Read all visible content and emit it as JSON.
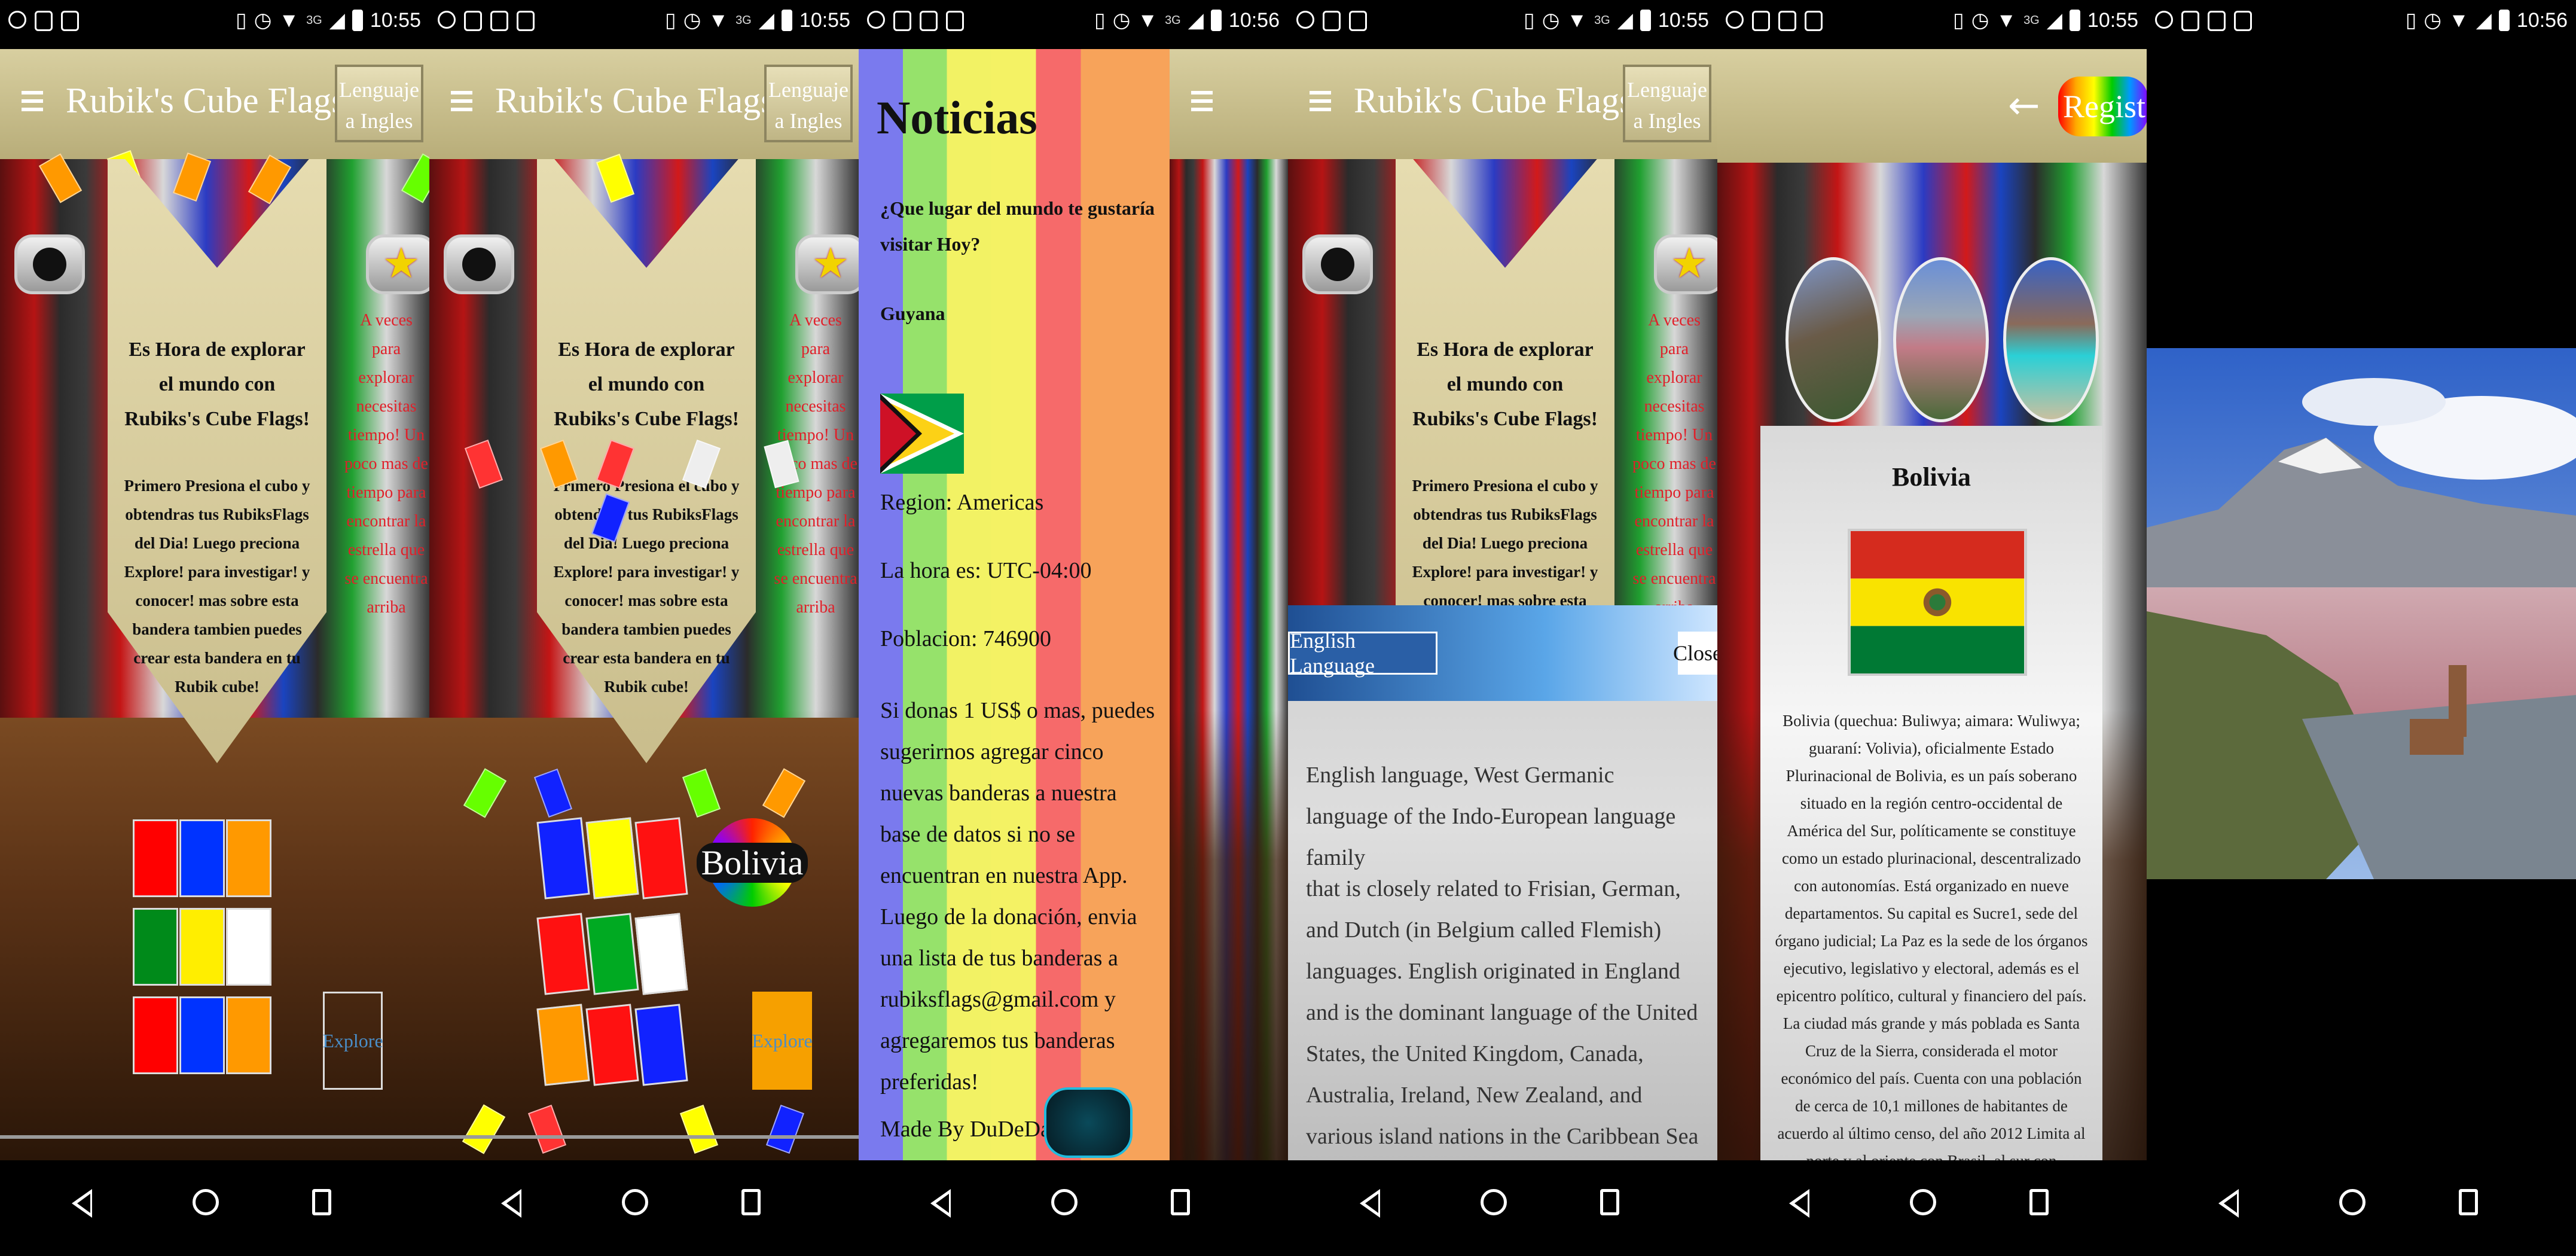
{
  "status": {
    "time_1": "10:55",
    "time_2": "10:55",
    "time_3": "10:56",
    "time_4": "10:55",
    "time_5": "10:55",
    "time_6": "10:55",
    "time_7": "10:56",
    "network": "3G"
  },
  "appbar": {
    "title": "Rubik's Cube Flags",
    "lang_button": "Lenguaje a Ingles"
  },
  "home": {
    "intro": "Es Hora de explorar el mundo con Rubiks's Cube Flags!",
    "instructions": "Primero Presiona el cubo y obtendras tus RubiksFlags del Dia! Luego preciona Explore! para investigar! y conocer! mas sobre esta bandera tambien puedes crear esta bandera en tu Rubik cube!",
    "side_note": "A veces para explorar necesitas tiempo! Un poco mas de tiempo para encontrar la estrella que se encuentra arriba",
    "explore_label": "Explore",
    "country_pill": "Bolivia",
    "cube_colors": [
      "#ff0000",
      "#0033ff",
      "#ff9900",
      "#008a1a",
      "#ffee00",
      "#ffffff",
      "#ff0000",
      "#0033ff",
      "#ff9900"
    ],
    "accent_orange": "#f6a000"
  },
  "news": {
    "title": "Noticias",
    "question": "¿Que lugar del mundo te gustaría visitar Hoy?",
    "country": "Guyana",
    "region": "Region: Americas",
    "time": "La hora es: UTC-04:00",
    "population": "Poblacion: 746900",
    "donation": "Si donas 1 US$ o mas, puedes sugerirnos agregar cinco nuevas banderas a nuestra base de datos si no se encuentran en nuestra App. Luego de la donación, envia una lista de tus banderas a rubiksflags@gmail.com y agregaremos tus banderas preferidas!",
    "credit": "Made By DuDeDa",
    "stripe_colors": [
      "#7a7aee",
      "#96e26b",
      "#f2f264",
      "#f66a6a",
      "#f7a35a"
    ]
  },
  "dialog": {
    "tag": "English Language",
    "close": "Close",
    "para_1": "English language, West Germanic language of the Indo-European language family",
    "para_2": "that is closely related to Frisian, German, and Dutch (in Belgium called Flemish) languages. English originated in England and is the dominant language of the United States, the United Kingdom, Canada, Australia, Ireland, New Zealand, and various island nations in the Caribbean Sea and the Pacific Ocean. It is also an"
  },
  "detail": {
    "register": "Register",
    "country": "Bolivia",
    "description": "Bolivia (quechua: Buliwya; aimara: Wuliwya; guaraní: Volivia), oficialmente Estado Plurinacional de Bolivia, es un país soberano situado en la región centro-occidental de América del Sur, políticamente se constituye como un estado plurinacional, descentralizado con autonomías. Está organizado en nueve departamentos. Su capital es Sucre1, sede del órgano judicial; La Paz es la sede de los órganos ejecutivo, legislativo y electoral, además es el epicentro político, cultural y financiero del país. La ciudad más grande y más poblada es Santa Cruz de la Sierra, considerada el motor económico del país. Cuenta con una población de cerca de 10,1 millones de habitantes de acuerdo al último censo, del año 2012 Limita al norte y al oriente con Brasil, al sur con Paraguay y Argentina, y al occidente con Chile y Perú, no tiene salida al mar. Su superficie es la sexta más extensa de Iberoa"
  }
}
